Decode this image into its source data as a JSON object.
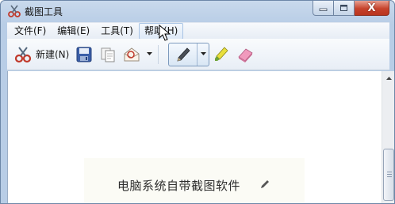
{
  "window": {
    "title": "截图工具",
    "close_symbol": "X"
  },
  "menu": {
    "items": [
      {
        "label": "文件(F)"
      },
      {
        "label": "编辑(E)"
      },
      {
        "label": "工具(T)"
      },
      {
        "label": "帮助(H)"
      }
    ]
  },
  "toolbar": {
    "new_label": "新建(N)",
    "icons": [
      "scissors-icon",
      "save-icon",
      "copy-icon",
      "send-email-icon",
      "pen-icon",
      "highlighter-icon",
      "eraser-icon"
    ]
  },
  "content": {
    "caption": "电脑系统自带截图软件"
  },
  "colors": {
    "frame": "#b8cde6",
    "close": "#c7432c",
    "canvas": "#ffffff"
  }
}
